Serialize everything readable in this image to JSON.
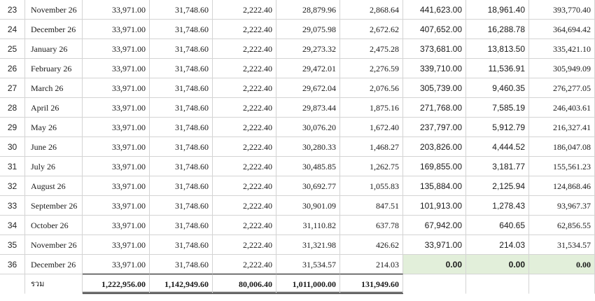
{
  "rows": [
    {
      "n": "23",
      "month": "November 26",
      "a": "33,971.00",
      "b": "31,748.60",
      "c": "2,222.40",
      "d": "28,879.96",
      "e": "2,868.64",
      "f": "441,623.00",
      "g": "18,961.40",
      "h": "393,770.40"
    },
    {
      "n": "24",
      "month": "December 26",
      "a": "33,971.00",
      "b": "31,748.60",
      "c": "2,222.40",
      "d": "29,075.98",
      "e": "2,672.62",
      "f": "407,652.00",
      "g": "16,288.78",
      "h": "364,694.42"
    },
    {
      "n": "25",
      "month": "January 26",
      "a": "33,971.00",
      "b": "31,748.60",
      "c": "2,222.40",
      "d": "29,273.32",
      "e": "2,475.28",
      "f": "373,681.00",
      "g": "13,813.50",
      "h": "335,421.10"
    },
    {
      "n": "26",
      "month": "February 26",
      "a": "33,971.00",
      "b": "31,748.60",
      "c": "2,222.40",
      "d": "29,472.01",
      "e": "2,276.59",
      "f": "339,710.00",
      "g": "11,536.91",
      "h": "305,949.09"
    },
    {
      "n": "27",
      "month": "March 26",
      "a": "33,971.00",
      "b": "31,748.60",
      "c": "2,222.40",
      "d": "29,672.04",
      "e": "2,076.56",
      "f": "305,739.00",
      "g": "9,460.35",
      "h": "276,277.05"
    },
    {
      "n": "28",
      "month": "April 26",
      "a": "33,971.00",
      "b": "31,748.60",
      "c": "2,222.40",
      "d": "29,873.44",
      "e": "1,875.16",
      "f": "271,768.00",
      "g": "7,585.19",
      "h": "246,403.61"
    },
    {
      "n": "29",
      "month": "May  26",
      "a": "33,971.00",
      "b": "31,748.60",
      "c": "2,222.40",
      "d": "30,076.20",
      "e": "1,672.40",
      "f": "237,797.00",
      "g": "5,912.79",
      "h": "216,327.41"
    },
    {
      "n": "30",
      "month": "June 26",
      "a": "33,971.00",
      "b": "31,748.60",
      "c": "2,222.40",
      "d": "30,280.33",
      "e": "1,468.27",
      "f": "203,826.00",
      "g": "4,444.52",
      "h": "186,047.08"
    },
    {
      "n": "31",
      "month": "July 26",
      "a": "33,971.00",
      "b": "31,748.60",
      "c": "2,222.40",
      "d": "30,485.85",
      "e": "1,262.75",
      "f": "169,855.00",
      "g": "3,181.77",
      "h": "155,561.23"
    },
    {
      "n": "32",
      "month": "August 26",
      "a": "33,971.00",
      "b": "31,748.60",
      "c": "2,222.40",
      "d": "30,692.77",
      "e": "1,055.83",
      "f": "135,884.00",
      "g": "2,125.94",
      "h": "124,868.46"
    },
    {
      "n": "33",
      "month": "September 26",
      "a": "33,971.00",
      "b": "31,748.60",
      "c": "2,222.40",
      "d": "30,901.09",
      "e": "847.51",
      "f": "101,913.00",
      "g": "1,278.43",
      "h": "93,967.37"
    },
    {
      "n": "34",
      "month": "October 26",
      "a": "33,971.00",
      "b": "31,748.60",
      "c": "2,222.40",
      "d": "31,110.82",
      "e": "637.78",
      "f": "67,942.00",
      "g": "640.65",
      "h": "62,856.55"
    },
    {
      "n": "35",
      "month": "November 26",
      "a": "33,971.00",
      "b": "31,748.60",
      "c": "2,222.40",
      "d": "31,321.98",
      "e": "426.62",
      "f": "33,971.00",
      "g": "214.03",
      "h": "31,534.57"
    },
    {
      "n": "36",
      "month": "December 26",
      "a": "33,971.00",
      "b": "31,748.60",
      "c": "2,222.40",
      "d": "31,534.57",
      "e": "214.03",
      "f": "0.00",
      "g": "0.00",
      "h": "0.00"
    }
  ],
  "totals": {
    "label": "รวม",
    "a": "1,222,956.00",
    "b": "1,142,949.60",
    "c": "80,006.40",
    "d": "1,011,000.00",
    "e": "131,949.60"
  },
  "colors": {
    "highlight": "#e2efda",
    "gridline": "#d4d4d4"
  }
}
